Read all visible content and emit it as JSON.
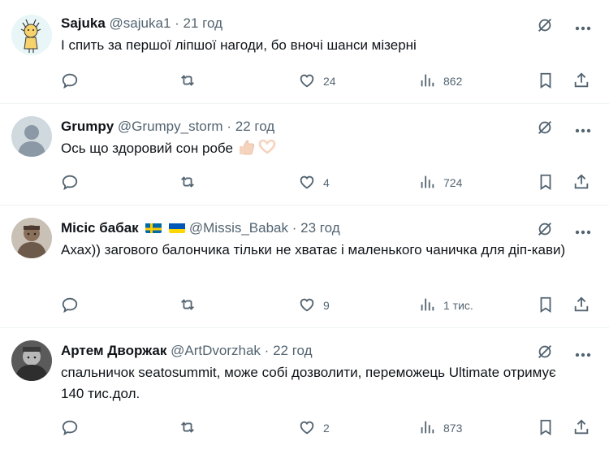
{
  "tweets": [
    {
      "name": "Sajuka",
      "handle": "@sajuka1",
      "dot": "·",
      "time": "21 год",
      "text": "І спить за першої ліпшої нагоди, бо вночі шанси мізерні",
      "likes": "24",
      "views": "862"
    },
    {
      "name": "Grumpy",
      "handle": "@Grumpy_storm",
      "dot": "·",
      "time": "22 год",
      "text": "Ось що здоровий сон робе",
      "likes": "4",
      "views": "724"
    },
    {
      "name": "Місіс бабак",
      "handle": "@Missis_Babak",
      "dot": "·",
      "time": "23 год",
      "text": "Ахах)) загового балончика тільки не хватає і маленького чаничка для діп-кави)",
      "likes": "9",
      "views": "1 тис."
    },
    {
      "name": "Артем Дворжак",
      "handle": "@ArtDvorzhak",
      "dot": "·",
      "time": "22 год",
      "text": "спальничок seatosummit, може собі дозволити, переможець Ultimate отримує 140 тис.дол.",
      "likes": "2",
      "views": "873"
    }
  ],
  "icons": {
    "grok": "grok-icon",
    "more": "more-icon",
    "reply": "reply-icon",
    "retweet": "retweet-icon",
    "like": "heart-icon",
    "views": "views-icon",
    "bookmark": "bookmark-icon",
    "share": "share-icon"
  },
  "colors": {
    "text": "#0f1419",
    "muted": "#536471",
    "divider": "#eff3f4"
  }
}
